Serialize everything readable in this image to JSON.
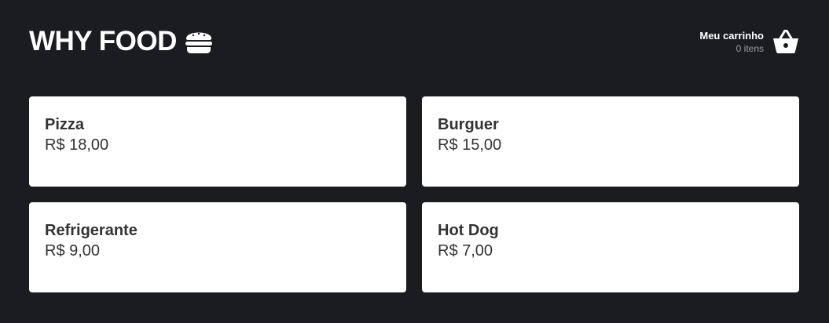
{
  "header": {
    "logo_text": "WHY FOOD",
    "logo_icon": "hamburger-icon",
    "cart": {
      "title": "Meu carrinho",
      "count_text": "0 itens",
      "icon": "shopping-basket-icon"
    }
  },
  "products": [
    {
      "name": "Pizza",
      "price": "R$ 18,00"
    },
    {
      "name": "Burguer",
      "price": "R$ 15,00"
    },
    {
      "name": "Refrigerante",
      "price": "R$ 9,00"
    },
    {
      "name": "Hot Dog",
      "price": "R$ 7,00"
    }
  ],
  "colors": {
    "background": "#1b1c21",
    "card": "#ffffff",
    "text_dark": "#333333",
    "text_muted": "#9a9a9f"
  }
}
